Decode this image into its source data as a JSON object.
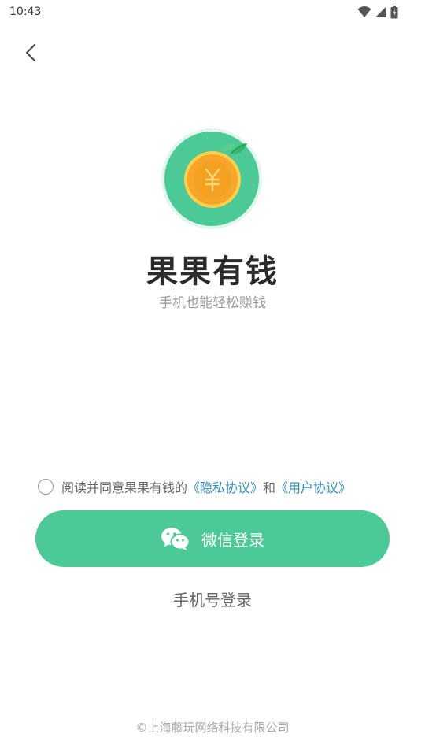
{
  "status_bar": {
    "time": "10:43",
    "icons": [
      "wifi-icon",
      "cell-signal-icon",
      "battery-charging-icon"
    ]
  },
  "nav": {
    "back_icon": "chevron-left-icon"
  },
  "logo": {
    "icon": "orange-coin-yuan-icon",
    "symbol": "¥",
    "colors": {
      "ring": "#4bc996",
      "halo": "#e3f6ed",
      "coin": "#f7a52b",
      "coin_inner": "#f39f1b",
      "rim": "#ffd04a",
      "leaf": "#39b56a"
    }
  },
  "app": {
    "name": "果果有钱",
    "slogan": "手机也能轻松赚钱"
  },
  "agreement": {
    "prefix": "阅读并同意果果有钱的",
    "privacy_link": "《隐私协议》",
    "conjunction": "和",
    "user_link": "《用户协议》"
  },
  "buttons": {
    "wechat_login": "微信登录",
    "wechat_icon": "wechat-icon",
    "phone_login": "手机号登录"
  },
  "footer": {
    "copyright": "©上海藤玩网络科技有限公司"
  },
  "colors": {
    "accent": "#4bc996",
    "link": "#2e8bb8",
    "title": "#2b2b2b",
    "subtle": "#9a9a9a"
  }
}
